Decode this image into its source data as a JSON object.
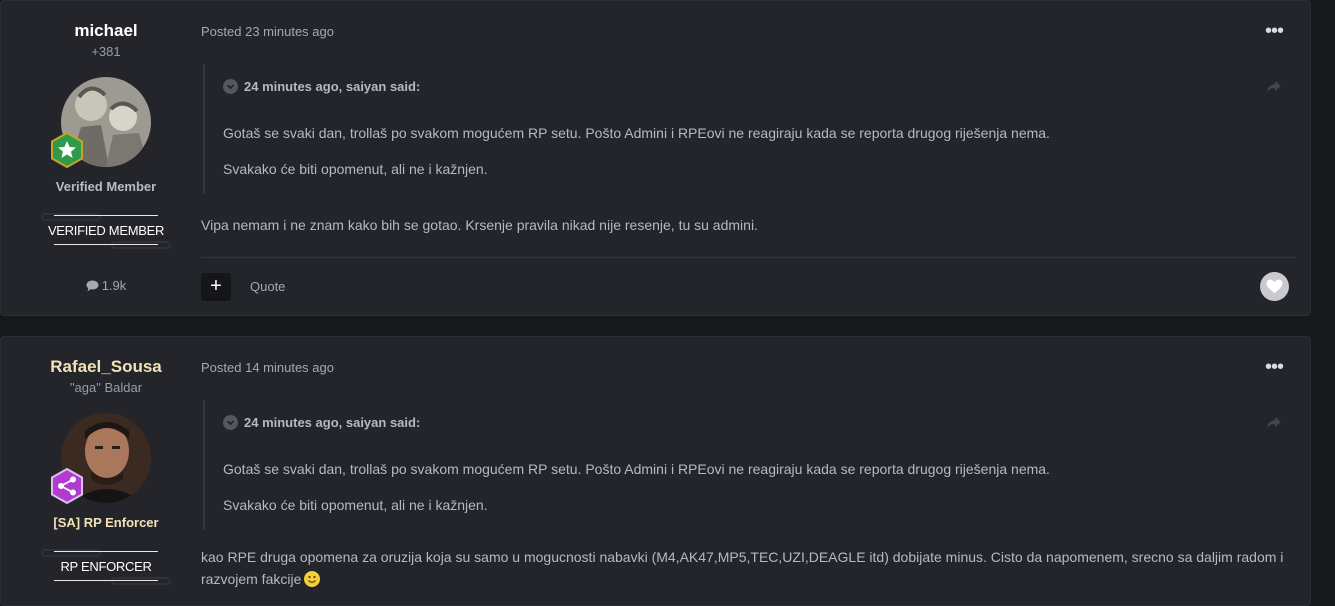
{
  "posts": [
    {
      "author": {
        "name": "michael",
        "subtitle": "+381",
        "group_title": "Verified Member",
        "group_badge": "VERIFIED MEMBER",
        "post_count": "1.9k",
        "rank_icon": "star-icon",
        "rank_color": "#2e9b4a"
      },
      "meta": {
        "posted": "Posted 23 minutes ago"
      },
      "quote": {
        "header": "24 minutes ago, saiyan said:",
        "lines": [
          "Gotaš se svaki dan, trollaš po svakom mogućem RP setu. Pošto Admini i RPEovi ne reagiraju kada se reporta drugog riješenja nema.",
          "Svakako će biti opomenut, ali ne i kažnjen."
        ]
      },
      "body": "Vipa nemam i ne znam kako bih se gotao. Krsenje pravila nikad nije resenje, tu su admini.",
      "actions": {
        "quote": "Quote"
      }
    },
    {
      "author": {
        "name": "Rafael_Sousa",
        "subtitle": "\"aga\" Baldar",
        "group_title": "[SA] RP Enforcer",
        "group_badge": "RP ENFORCER",
        "rank_icon": "share-nodes-icon",
        "rank_color": "#b23ad1"
      },
      "meta": {
        "posted": "Posted 14 minutes ago"
      },
      "quote": {
        "header": "24 minutes ago, saiyan said:",
        "lines": [
          "Gotaš se svaki dan, trollaš po svakom mogućem RP setu. Pošto Admini i RPEovi ne reagiraju kada se reporta drugog riješenja nema.",
          "Svakako će biti opomenut, ali ne i kažnjen."
        ]
      },
      "body": "kao RPE druga opomena za oruzija koja su samo u mogucnosti nabavki (M4,AK47,MP5,TEC,UZI,DEAGLE itd) dobijate minus. Cisto da napomenem, srecno sa daljim radom i razvojem fakcije"
    }
  ]
}
